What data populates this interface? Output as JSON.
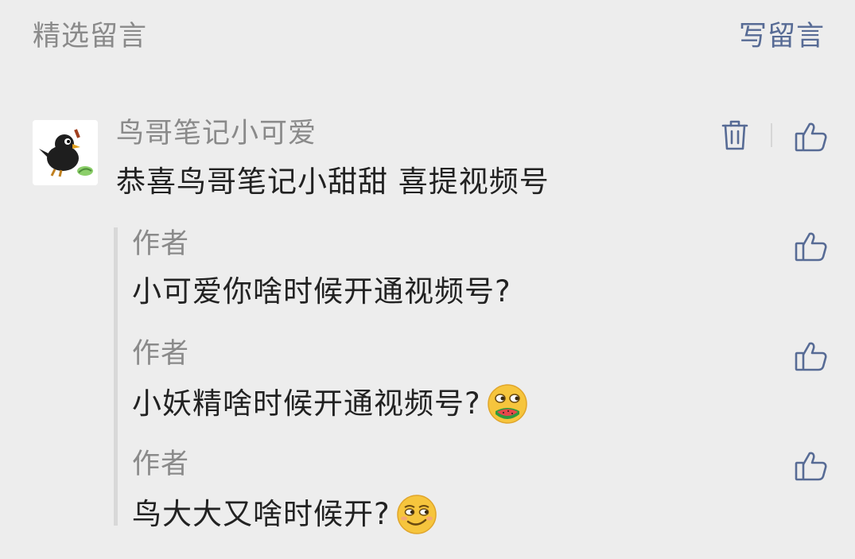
{
  "header": {
    "title": "精选留言",
    "write_label": "写留言"
  },
  "comment": {
    "author": "鸟哥笔记小可爱",
    "text": "恭喜鸟哥笔记小甜甜 喜提视频号",
    "avatar_icon": "crow-cartoon-avatar"
  },
  "replies": [
    {
      "author": "作者",
      "text": "小可爱你啥时候开通视频号?",
      "emoji": null
    },
    {
      "author": "作者",
      "text": "小妖精啥时候开通视频号?",
      "emoji": "watermelon-eating-emoji"
    },
    {
      "author": "作者",
      "text": "鸟大大又啥时候开?",
      "emoji": "smirk-emoji"
    }
  ],
  "icons": {
    "delete": "trash-icon",
    "like": "thumbs-up-icon"
  },
  "colors": {
    "background": "#ededed",
    "link": "#576b95",
    "muted_text": "#8a8a8a",
    "body_text": "#222222"
  }
}
